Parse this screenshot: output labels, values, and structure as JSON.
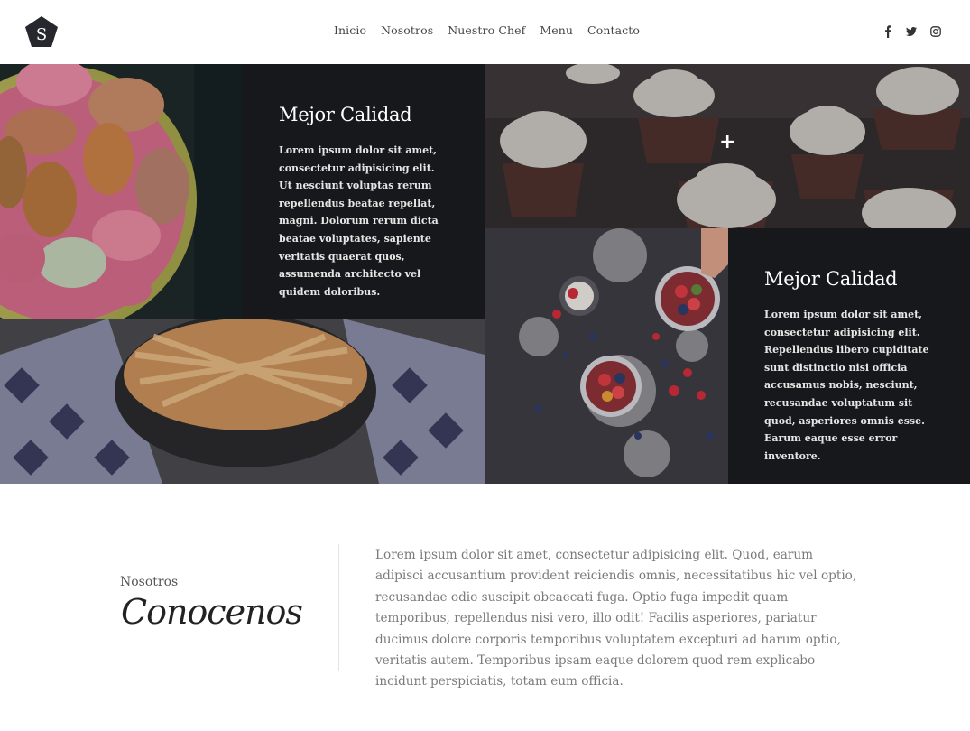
{
  "header": {
    "nav": [
      "Inicio",
      "Nosotros",
      "Nuestro Chef",
      "Menu",
      "Contacto"
    ],
    "logo_letter": "S",
    "social_icons": [
      "facebook-icon",
      "twitter-icon",
      "instagram-icon"
    ]
  },
  "features": [
    {
      "title": "Mejor Calidad",
      "text": "Lorem ipsum dolor sit amet, consectetur adipisicing elit. Ut nesciunt voluptas rerum repellendus beatae repellat, magni. Dolorum rerum dicta beatae voluptates, sapiente veritatis quaerat quos, assumenda architecto vel quidem doloribus."
    },
    {
      "title": "Mejor Calidad",
      "text": "Lorem ipsum dolor sit amet, consectetur adipisicing elit. Repellendus libero cupiditate sunt distinctio nisi officia accusamus nobis, nesciunt, recusandae voluptatum sit quod, asperiores omnis esse. Earum eaque esse error inventore."
    }
  ],
  "gallery": {
    "plus_icon": "+"
  },
  "about": {
    "kicker": "Nosotros",
    "title": "Conocenos",
    "text": "Lorem ipsum dolor sit amet, consectetur adipisicing elit. Quod, earum adipisci accusantium provident reiciendis omnis, necessitatibus hic vel optio, recusandae odio suscipit obcaecati fuga. Optio fuga impedit quam temporibus, repellendus nisi vero, illo odit! Facilis asperiores, pariatur ducimus dolore corporis temporibus voluptatem excepturi ad harum optio, veritatis autem. Temporibus ipsam eaque dolorem quod rem explicabo incidunt perspiciatis, totam eum officia."
  },
  "colors": {
    "panel_bg": "#17181b",
    "text_muted": "#7a7a7a",
    "nav_text": "#444444"
  }
}
